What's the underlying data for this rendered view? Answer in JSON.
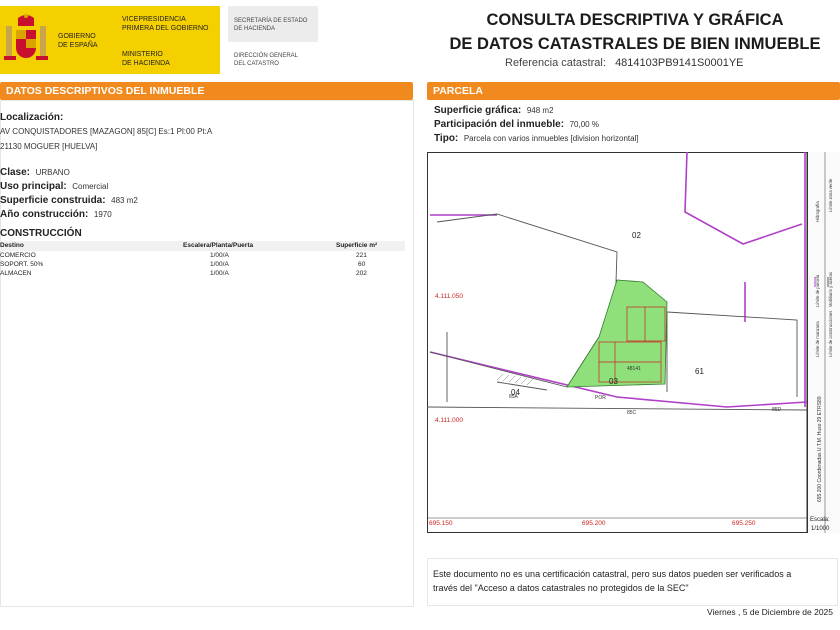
{
  "header": {
    "country_l1": "GOBIERNO",
    "country_l2": "DE ESPAÑA",
    "vice_l1": "VICEPRESIDENCIA",
    "vice_l2": "PRIMERA DEL GOBIERNO",
    "min_l1": "MINISTERIO",
    "min_l2": "DE HACIENDA",
    "sec_l1": "SECRETARÍA DE ESTADO",
    "sec_l2": "DE HACIENDA",
    "dir_l1": "DIRECCIÓN GENERAL",
    "dir_l2": "DEL CATASTRO",
    "title_l1": "CONSULTA DESCRIPTIVA Y GRÁFICA",
    "title_l2": "DE DATOS CATASTRALES DE BIEN INMUEBLE",
    "ref_label": "Referencia catastral:",
    "ref_value": "4814103PB9141S0001YE"
  },
  "left": {
    "bar": "DATOS DESCRIPTIVOS DEL INMUEBLE",
    "loc_label": "Localización:",
    "loc_l1": "AV CONQUISTADORES [MAZAGON] 85[C] Es:1 Pl:00 Pt:A",
    "loc_l2": "21130 MOGUER [HUELVA]",
    "clase_label": "Clase:",
    "clase_value": "URBANO",
    "uso_label": "Uso principal:",
    "uso_value": "Comercial",
    "sup_label": "Superficie construida:",
    "sup_value": "483 m2",
    "anio_label": "Año construcción:",
    "anio_value": "1970",
    "constr_title": "CONSTRUCCIÓN",
    "table": {
      "headers": [
        "Destino",
        "Escalera/Planta/Puerta",
        "Superficie m²"
      ],
      "rows": [
        [
          "COMERCIO",
          "1/00/A",
          "221"
        ],
        [
          "SOPORT. 50%",
          "1/00/A",
          "60"
        ],
        [
          "ALMACEN",
          "1/00/A",
          "202"
        ]
      ]
    }
  },
  "right": {
    "bar": "PARCELA",
    "sup_label": "Superficie gráfica:",
    "sup_value": "948 m2",
    "part_label": "Participación del inmueble:",
    "part_value": "70,00 %",
    "tipo_label": "Tipo:",
    "tipo_value": "Parcela con varios inmuebles [division horizontal]"
  },
  "map": {
    "parcels": [
      "02",
      "04",
      "03",
      "61"
    ],
    "y_ticks": [
      "4.111.050",
      "4.111.000"
    ],
    "x_ticks": [
      "695.150",
      "695.200",
      "695.250"
    ],
    "streets": [
      "85A",
      "85C",
      "85D"
    ],
    "small_labels": [
      "48141",
      "POR"
    ],
    "scale_label": "Escala:",
    "scale_value": "1/1000",
    "side_text": "695.200 Coordenadas U.T.M. Huso 29 ETRS89",
    "legend": [
      "Límite de manzana",
      "Límite de parcela",
      "Límite de construcciones",
      "Mobiliario y aceras",
      "Límite zona verde",
      "Hidrografía"
    ],
    "colors": {
      "parcel_line": "#b040c8",
      "green": "#8fe07a",
      "red": "#cc2222"
    }
  },
  "footer": {
    "note_l1": "Este documento no es una certificación catastral, pero sus datos pueden ser verificados a",
    "note_l2": "través del \"Acceso a datos catastrales no protegidos de la SEC\"",
    "date": "Viernes , 5 de Diciembre de 2025"
  }
}
